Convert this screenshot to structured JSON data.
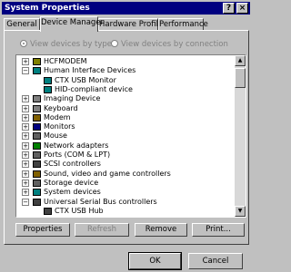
{
  "window": {
    "title": "System Properties",
    "help_label": "?",
    "close_label": "×"
  },
  "tabs": [
    {
      "label": "General"
    },
    {
      "label": "Device Manager"
    },
    {
      "label": "Hardware Profiles"
    },
    {
      "label": "Performance"
    }
  ],
  "view_options": {
    "by_type": "View devices by type",
    "by_connection": "View devices by connection",
    "selected": "by_type"
  },
  "tree_items": [
    {
      "label": "HCFMODEM",
      "expander": "+",
      "icon": "modem-icon",
      "color": "#808000"
    },
    {
      "label": "Human Interface Devices",
      "expander": "−",
      "icon": "hid-icon",
      "color": "#008080"
    },
    {
      "label": "CTX USB Monitor",
      "expander": "",
      "icon": "hid-device-icon",
      "color": "#008080"
    },
    {
      "label": "HID-compliant device",
      "expander": "",
      "icon": "hid-device-icon",
      "color": "#008080"
    },
    {
      "label": "Imaging Device",
      "expander": "+",
      "icon": "camera-icon",
      "color": "#808080"
    },
    {
      "label": "Keyboard",
      "expander": "+",
      "icon": "keyboard-icon",
      "color": "#808080"
    },
    {
      "label": "Modem",
      "expander": "+",
      "icon": "modem-icon",
      "color": "#806000"
    },
    {
      "label": "Monitors",
      "expander": "+",
      "icon": "monitor-icon",
      "color": "#000080"
    },
    {
      "label": "Mouse",
      "expander": "+",
      "icon": "mouse-icon",
      "color": "#606060"
    },
    {
      "label": "Network adapters",
      "expander": "+",
      "icon": "network-icon",
      "color": "#008000"
    },
    {
      "label": "Ports (COM & LPT)",
      "expander": "+",
      "icon": "port-icon",
      "color": "#606060"
    },
    {
      "label": "SCSI controllers",
      "expander": "+",
      "icon": "scsi-icon",
      "color": "#404040"
    },
    {
      "label": "Sound, video and game controllers",
      "expander": "+",
      "icon": "sound-icon",
      "color": "#806000"
    },
    {
      "label": "Storage device",
      "expander": "+",
      "icon": "storage-icon",
      "color": "#606060"
    },
    {
      "label": "System devices",
      "expander": "+",
      "icon": "system-icon",
      "color": "#008080"
    },
    {
      "label": "Universal Serial Bus controllers",
      "expander": "−",
      "icon": "usb-icon",
      "color": "#404040"
    },
    {
      "label": "CTX USB Hub",
      "expander": "",
      "icon": "usb-hub-icon",
      "color": "#404040"
    }
  ],
  "buttons": {
    "properties": "Properties",
    "refresh": "Refresh",
    "remove": "Remove",
    "print": "Print...",
    "ok": "OK",
    "cancel": "Cancel"
  },
  "colors": {
    "title_bar": "#000080",
    "face": "#c0c0c0",
    "list_bg": "#ffffff"
  }
}
